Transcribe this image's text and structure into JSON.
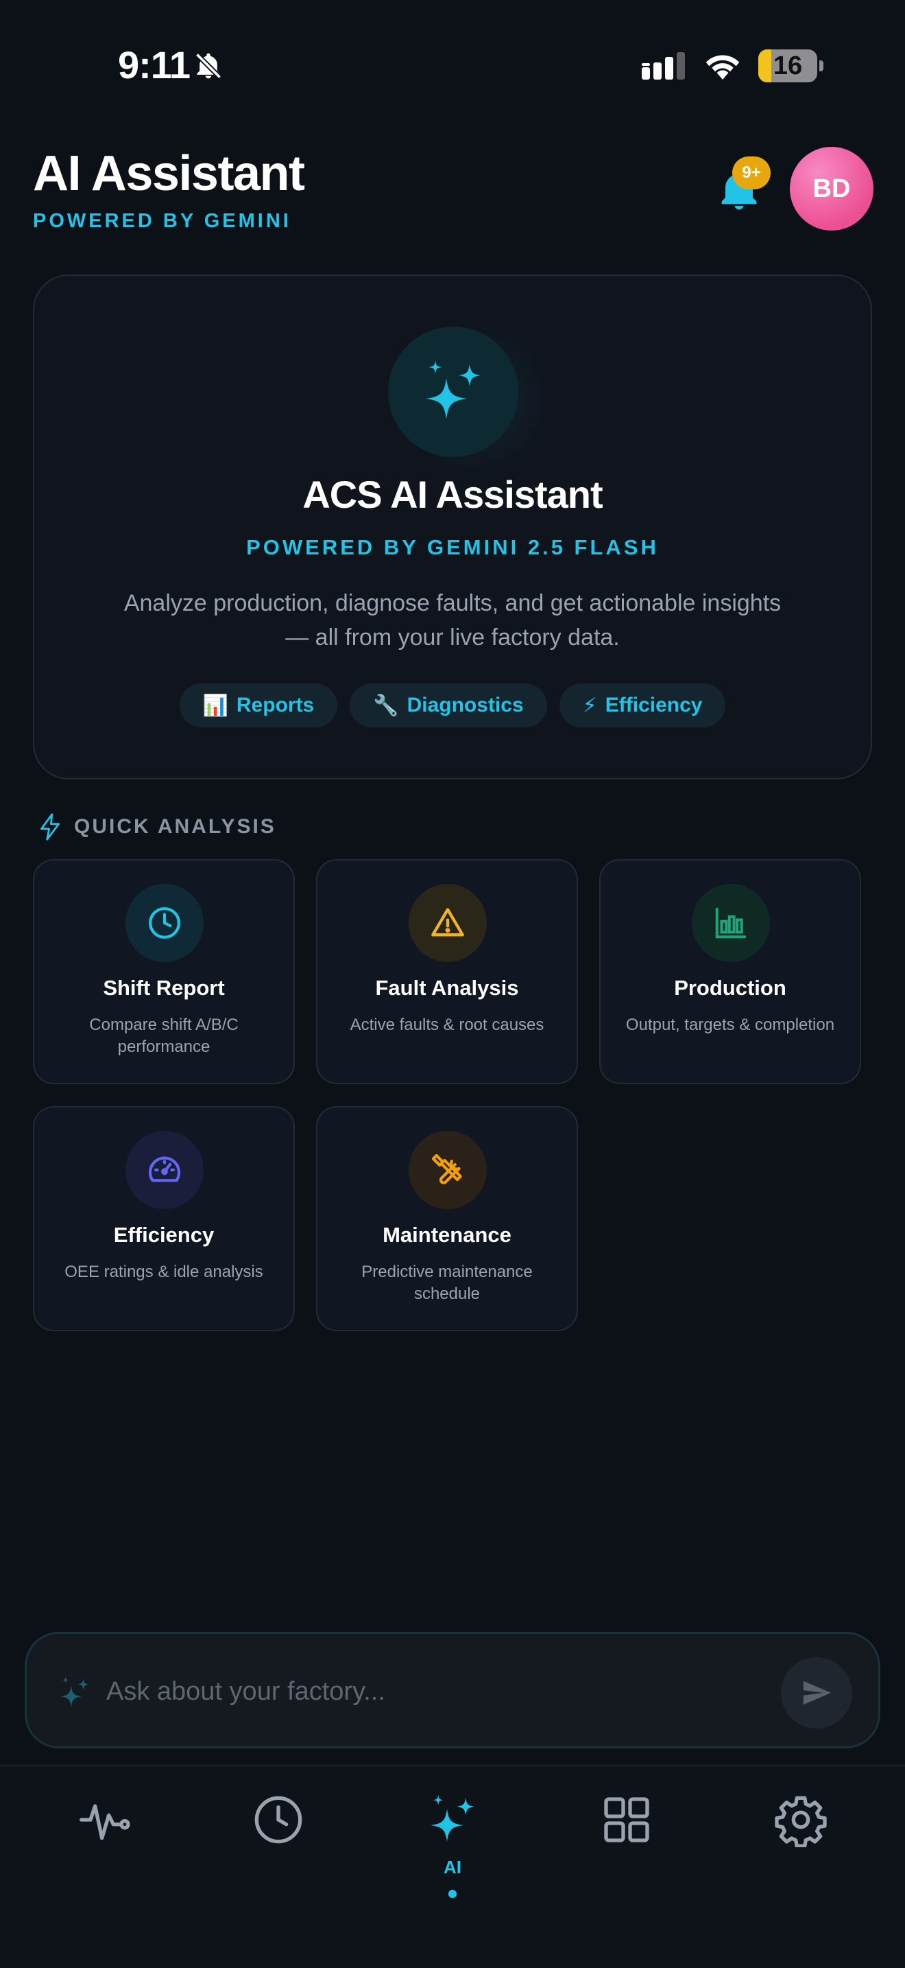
{
  "status_bar": {
    "time": "9:11",
    "battery": "16",
    "icons": [
      "bell-slash-icon",
      "signal-icon",
      "wifi-icon",
      "battery-icon"
    ]
  },
  "header": {
    "title": "AI Assistant",
    "subtitle": "POWERED BY GEMINI",
    "notification_badge": "9+",
    "avatar_initials": "BD"
  },
  "hero": {
    "icon": "sparkles-icon",
    "title": "ACS AI Assistant",
    "subtitle": "POWERED BY GEMINI 2.5 FLASH",
    "description": "Analyze production, diagnose faults, and get actionable insights — all from your live factory data.",
    "chips": [
      {
        "emoji": "📊",
        "label": "Reports"
      },
      {
        "emoji": "🔧",
        "label": "Diagnostics"
      },
      {
        "emoji": "⚡",
        "label": "Efficiency"
      }
    ]
  },
  "quick_analysis": {
    "heading": "QUICK ANALYSIS",
    "items": [
      {
        "title": "Shift Report",
        "description": "Compare shift A/B/C performance",
        "icon": "clock-icon",
        "color": "#22c3e6"
      },
      {
        "title": "Fault Analysis",
        "description": "Active faults & root causes",
        "icon": "warning-icon",
        "color": "#f0b429"
      },
      {
        "title": "Production",
        "description": "Output, targets & completion",
        "icon": "bar-chart-icon",
        "color": "#1fa37a"
      },
      {
        "title": "Efficiency",
        "description": "OEE ratings & idle analysis",
        "icon": "gauge-icon",
        "color": "#6366f1"
      },
      {
        "title": "Maintenance",
        "description": "Predictive maintenance schedule",
        "icon": "tools-icon",
        "color": "#f59e0b"
      }
    ]
  },
  "chat": {
    "placeholder": "Ask about your factory..."
  },
  "nav": {
    "items": [
      {
        "icon": "activity-icon",
        "label": ""
      },
      {
        "icon": "clock-icon",
        "label": ""
      },
      {
        "icon": "sparkles-icon",
        "label": "AI",
        "active": true
      },
      {
        "icon": "grid-icon",
        "label": ""
      },
      {
        "icon": "gear-icon",
        "label": ""
      }
    ]
  },
  "colors": {
    "background": "#0c1017",
    "accent": "#22c3e6",
    "badge": "#e8a70c",
    "avatar": "#ec4f94"
  }
}
